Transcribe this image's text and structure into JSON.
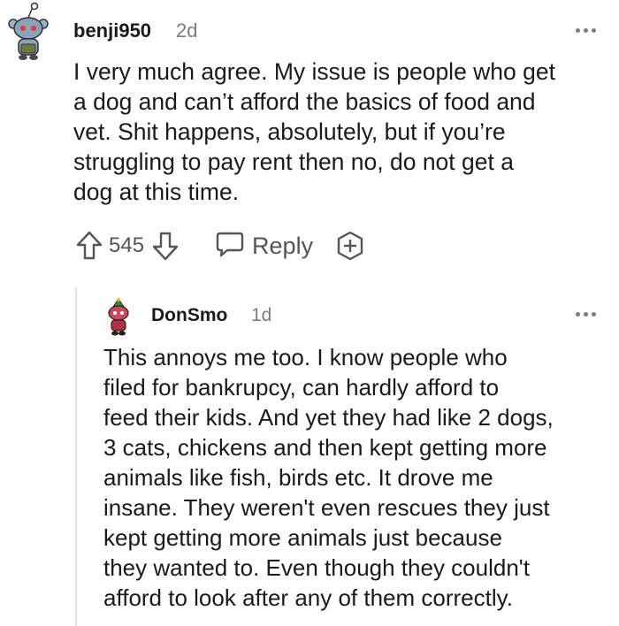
{
  "parent": {
    "username": "benji950",
    "age": "2d",
    "body": "I very much agree. My issue is people who get\na dog and can’t afford the basics of food and\nvet. Shit happens, absolutely, but if you’re\nstruggling to pay rent then no, do not get a\ndog at this time.",
    "votes": "545",
    "reply_label": "Reply",
    "avatar_icon": "snoo-avatar-icon",
    "upvote_icon": "upvote-arrow-icon",
    "downvote_icon": "downvote-arrow-icon",
    "reply_icon": "speech-bubble-icon",
    "award_icon": "award-plus-icon",
    "more_icon": "more-dots-icon"
  },
  "reply": {
    "username": "DonSmo",
    "age": "1d",
    "body": "This annoys me too. I know people who\nfiled for bankrupcy, can hardly afford to\nfeed their kids. And yet they had like 2 dogs,\n3 cats, chickens and then kept getting more\nanimals like fish, birds etc. It drove me\ninsane. They weren't even rescues they just\nkept getting more animals just because\nthey wanted to. Even though they couldn't\nafford to look after any of them correctly.",
    "avatar_icon": "snoo-avatar-icon",
    "more_icon": "more-dots-icon"
  },
  "colors": {
    "text": "#1a1a1b",
    "meta": "#7c7c7c",
    "icon": "#555555",
    "thread_line": "#e3e3e3"
  }
}
